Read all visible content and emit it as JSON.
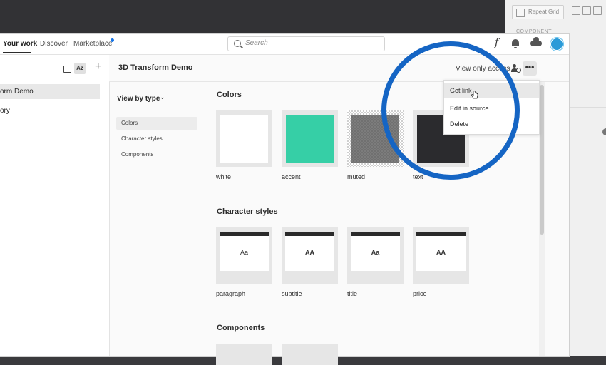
{
  "background_panel": {
    "repeat_grid_label": "Repeat Grid",
    "component_label": "COMPONENT"
  },
  "topnav": {
    "items": [
      {
        "label": "Your work"
      },
      {
        "label": "Discover"
      },
      {
        "label": "Marketplace"
      }
    ],
    "search_placeholder": "Search",
    "accent_color": "#1473e6"
  },
  "sidebar": {
    "items": [
      {
        "label": "orm Demo"
      },
      {
        "label": "ory"
      }
    ]
  },
  "document": {
    "title": "3D Transform Demo",
    "access_label": "View only access",
    "more_label": "•••"
  },
  "filter": {
    "view_by_label": "View by type",
    "options": [
      {
        "label": "Colors"
      },
      {
        "label": "Character styles"
      },
      {
        "label": "Components"
      }
    ]
  },
  "sections": {
    "colors": {
      "title": "Colors",
      "swatches": [
        {
          "name": "white",
          "color": "#ffffff"
        },
        {
          "name": "accent",
          "color": "#36cfa6"
        },
        {
          "name": "muted",
          "color": "#666666"
        },
        {
          "name": "text",
          "color": "#2b2b2e"
        }
      ]
    },
    "character_styles": {
      "title": "Character styles",
      "items": [
        {
          "name": "paragraph",
          "preview": "Aa"
        },
        {
          "name": "subtitle",
          "preview": "AA"
        },
        {
          "name": "title",
          "preview": "Aa"
        },
        {
          "name": "price",
          "preview": "AA"
        }
      ]
    },
    "components": {
      "title": "Components"
    }
  },
  "context_menu": {
    "items": [
      {
        "label": "Get link"
      },
      {
        "label": "Edit in source"
      },
      {
        "label": "Delete"
      }
    ]
  },
  "highlight_color": "#1565c4"
}
